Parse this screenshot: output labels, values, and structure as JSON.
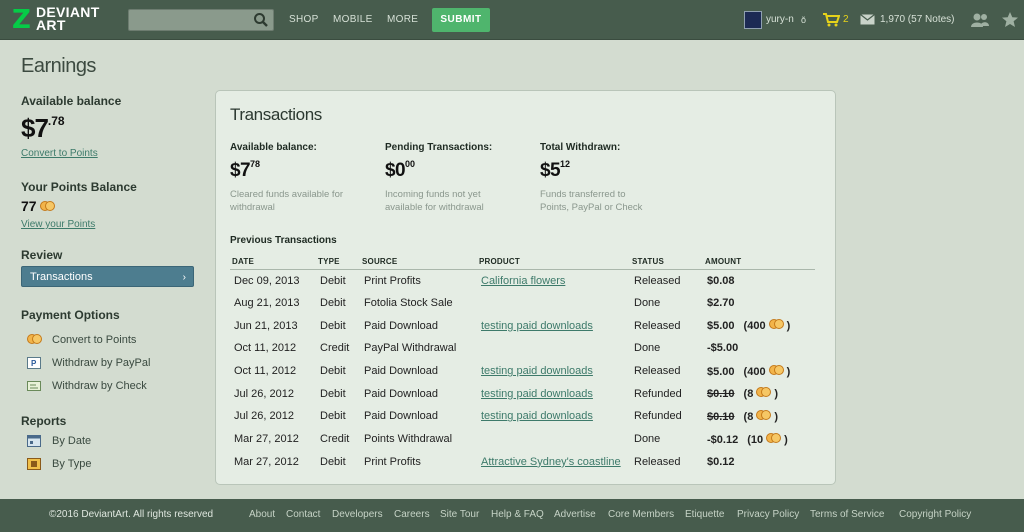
{
  "header": {
    "logo_line1": "DEVIANT",
    "logo_line2": "ART",
    "search_placeholder": "",
    "nav": [
      "SHOP",
      "MOBILE",
      "MORE"
    ],
    "submit_label": "SUBMIT",
    "username": "yury-n",
    "username_mark": "ŏ",
    "cart_count": "2",
    "notes": "1,970 (57 Notes)"
  },
  "sidebar": {
    "page_title": "Earnings",
    "available_balance_heading": "Available balance",
    "balance_dollars": "$7",
    "balance_cents": ".78",
    "convert_link": "Convert to Points",
    "points_heading": "Your Points Balance",
    "points_value": "77",
    "view_points_link": "View your Points",
    "review_heading": "Review",
    "review_item": "Transactions",
    "review_chevron": "›",
    "payment_heading": "Payment Options",
    "payment_items": [
      "Convert to Points",
      "Withdraw by PayPal",
      "Withdraw by Check"
    ],
    "reports_heading": "Reports",
    "report_items": [
      "By Date",
      "By Type"
    ]
  },
  "card": {
    "title": "Transactions",
    "summary": [
      {
        "heading": "Available balance:",
        "dollars": "$7",
        "cents": "78",
        "desc": "Cleared funds available for withdrawal"
      },
      {
        "heading": "Pending Transactions:",
        "dollars": "$0",
        "cents": "00",
        "desc": "Incoming funds not yet available for withdrawal"
      },
      {
        "heading": "Total Withdrawn:",
        "dollars": "$5",
        "cents": "12",
        "desc": "Funds transferred to Points, PayPal or Check"
      }
    ],
    "previous_heading": "Previous Transactions",
    "columns": [
      "DATE",
      "TYPE",
      "SOURCE",
      "PRODUCT",
      "STATUS",
      "AMOUNT"
    ],
    "rows": [
      {
        "date": "Dec 09, 2013",
        "type": "Debit",
        "source": "Print Profits",
        "product": "California flowers",
        "status": "Released",
        "amount": "$0.08",
        "strike": false,
        "points": ""
      },
      {
        "date": "Aug 21, 2013",
        "type": "Debit",
        "source": "Fotolia Stock Sale",
        "product": "",
        "status": "Done",
        "amount": "$2.70",
        "strike": false,
        "points": ""
      },
      {
        "date": "Jun 21, 2013",
        "type": "Debit",
        "source": "Paid Download",
        "product": "testing paid downloads",
        "status": "Released",
        "amount": "$5.00",
        "strike": false,
        "points": "400"
      },
      {
        "date": "Oct 11, 2012",
        "type": "Credit",
        "source": "PayPal Withdrawal",
        "product": "",
        "status": "Done",
        "amount": "-$5.00",
        "strike": false,
        "points": ""
      },
      {
        "date": "Oct 11, 2012",
        "type": "Debit",
        "source": "Paid Download",
        "product": "testing paid downloads",
        "status": "Released",
        "amount": "$5.00",
        "strike": false,
        "points": "400"
      },
      {
        "date": "Jul 26, 2012",
        "type": "Debit",
        "source": "Paid Download",
        "product": "testing paid downloads",
        "status": "Refunded",
        "amount": "$0.10",
        "strike": true,
        "points": "8"
      },
      {
        "date": "Jul 26, 2012",
        "type": "Debit",
        "source": "Paid Download",
        "product": "testing paid downloads",
        "status": "Refunded",
        "amount": "$0.10",
        "strike": true,
        "points": "8"
      },
      {
        "date": "Mar 27, 2012",
        "type": "Credit",
        "source": "Points Withdrawal",
        "product": "",
        "status": "Done",
        "amount": "-$0.12",
        "strike": false,
        "points": "10"
      },
      {
        "date": "Mar 27, 2012",
        "type": "Debit",
        "source": "Print Profits",
        "product": "Attractive Sydney's coastline",
        "status": "Released",
        "amount": "$0.12",
        "strike": false,
        "points": ""
      }
    ]
  },
  "footer": {
    "copyright": "©2016 DeviantArt. All rights reserved",
    "links": [
      "About",
      "Contact",
      "Developers",
      "Careers",
      "Site Tour",
      "Help & FAQ",
      "Advertise",
      "Core Members",
      "Etiquette",
      "Privacy Policy",
      "Terms of Service",
      "Copyright Policy"
    ]
  },
  "colors": {
    "header_bg": "#475c4d",
    "page_bg": "#d3dcd0",
    "card_bg": "#e5ede4",
    "submit_green": "#4fb56d",
    "review_active": "#4d7d8f",
    "link": "#3d7a6a"
  }
}
